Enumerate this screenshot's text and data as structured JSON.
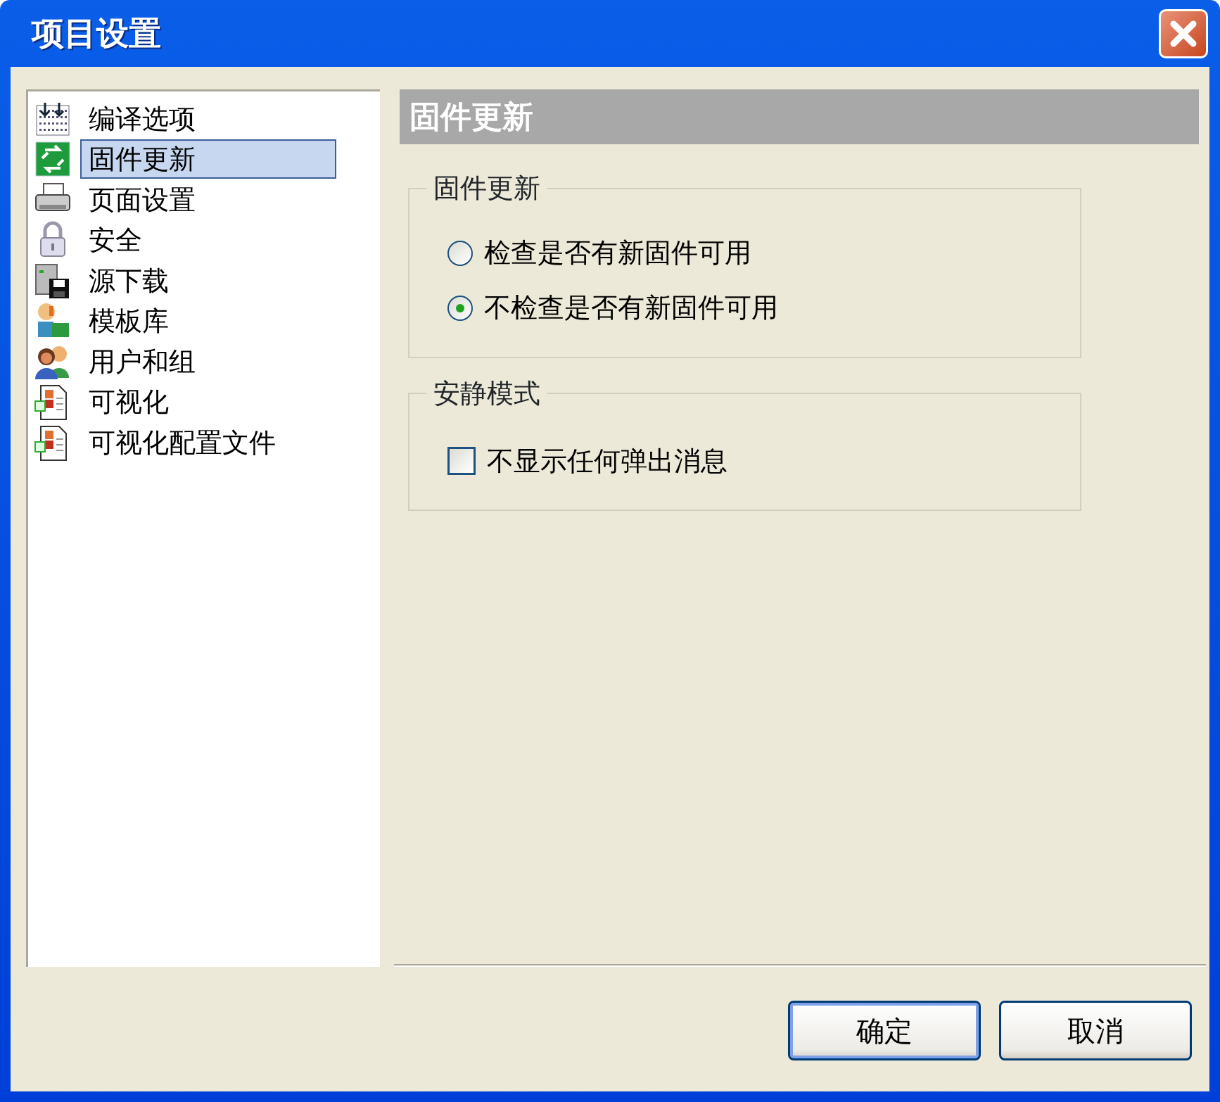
{
  "window": {
    "title": "项目设置"
  },
  "sidebar": {
    "items": [
      {
        "label": "编译选项",
        "selected": false
      },
      {
        "label": "固件更新",
        "selected": true
      },
      {
        "label": "页面设置",
        "selected": false
      },
      {
        "label": "安全",
        "selected": false
      },
      {
        "label": "源下载",
        "selected": false
      },
      {
        "label": "模板库",
        "selected": false
      },
      {
        "label": "用户和组",
        "selected": false
      },
      {
        "label": "可视化",
        "selected": false
      },
      {
        "label": "可视化配置文件",
        "selected": false
      }
    ]
  },
  "panel": {
    "header": "固件更新",
    "groups": [
      {
        "title": "固件更新",
        "options": [
          {
            "kind": "radio",
            "label": "检查是否有新固件可用",
            "selected": false
          },
          {
            "kind": "radio",
            "label": "不检查是否有新固件可用",
            "selected": true
          }
        ]
      },
      {
        "title": "安静模式",
        "options": [
          {
            "kind": "checkbox",
            "label": "不显示任何弹出消息",
            "checked": false
          }
        ]
      }
    ]
  },
  "buttons": [
    {
      "label": "确定",
      "default": true
    },
    {
      "label": "取消",
      "default": false
    }
  ]
}
